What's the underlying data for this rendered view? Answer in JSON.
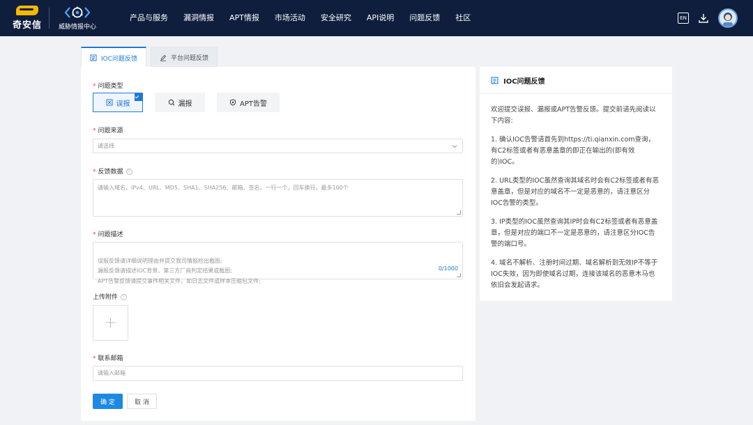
{
  "header": {
    "brand_name": "奇安信",
    "sub_brand_name": "威胁情报中心",
    "nav": [
      "产品与服务",
      "漏洞情报",
      "APT情报",
      "市场活动",
      "安全研究",
      "API说明",
      "问题反馈",
      "社区"
    ],
    "lang_label": "EN"
  },
  "tabs": [
    {
      "label": "IOC问题反馈",
      "active": true
    },
    {
      "label": "平台问题反馈",
      "active": false
    }
  ],
  "form": {
    "type_label": "问题类型",
    "type_options": [
      {
        "label": "误报",
        "selected": true
      },
      {
        "label": "漏报",
        "selected": false
      },
      {
        "label": "APT告警",
        "selected": false
      }
    ],
    "source_label": "问题来源",
    "source_placeholder": "请选择",
    "data_label": "反馈数据",
    "data_placeholder": "请输入域名、IPv4、URL、MD5、SHA1、SHA256、邮箱、签名，一行一个，回车换行，最多100个",
    "desc_label": "问题描述",
    "desc_placeholder": "误报反馈请详细说明理由并提交我司情报检出截图;\n漏报反馈请描述IOC背景、第三方厂商判定结果或截图;\nAPT告警反馈请提交事件相关文件，如日志文件或样本压缩包文件;",
    "desc_count": "0/1000",
    "upload_label": "上传附件",
    "upload_plus": "+",
    "email_label": "联系邮箱",
    "email_placeholder": "请输入邮箱",
    "submit_label": "确 定",
    "cancel_label": "取 消"
  },
  "side": {
    "title": "IOC问题反馈",
    "intro": "欢迎提交误报、漏报或APT告警反馈。提交前请先阅读以下内容:",
    "items": [
      "1. 确认IOC告警请首先到https://ti.qianxin.com查询，有C2标签或者有恶意盖章的即正在输出的(即有效的)IOC。",
      "2. URL类型的IOC虽然查询其域名时会有C2标签或者有恶意盖章，但是对应的域名不一定是恶意的，请注意区分IOC告警的类型。",
      "3. IP类型的IOC虽然查询其IP时会有C2标签或者有恶意盖章，但是对应的端口不一定是恶意的，请注意区分IOC告警的端口号。",
      "4. 域名不解析、注册时间过期、域名解析到无效IP不等于IOC失效，因为即使域名过期，连接该域名的恶意木马也依旧会发起请求。"
    ]
  },
  "colors": {
    "header_bg": "#0f1e3d",
    "accent": "#1e78d8",
    "page_bg": "#f0f2f5",
    "brand_yellow": "#f5b800"
  }
}
